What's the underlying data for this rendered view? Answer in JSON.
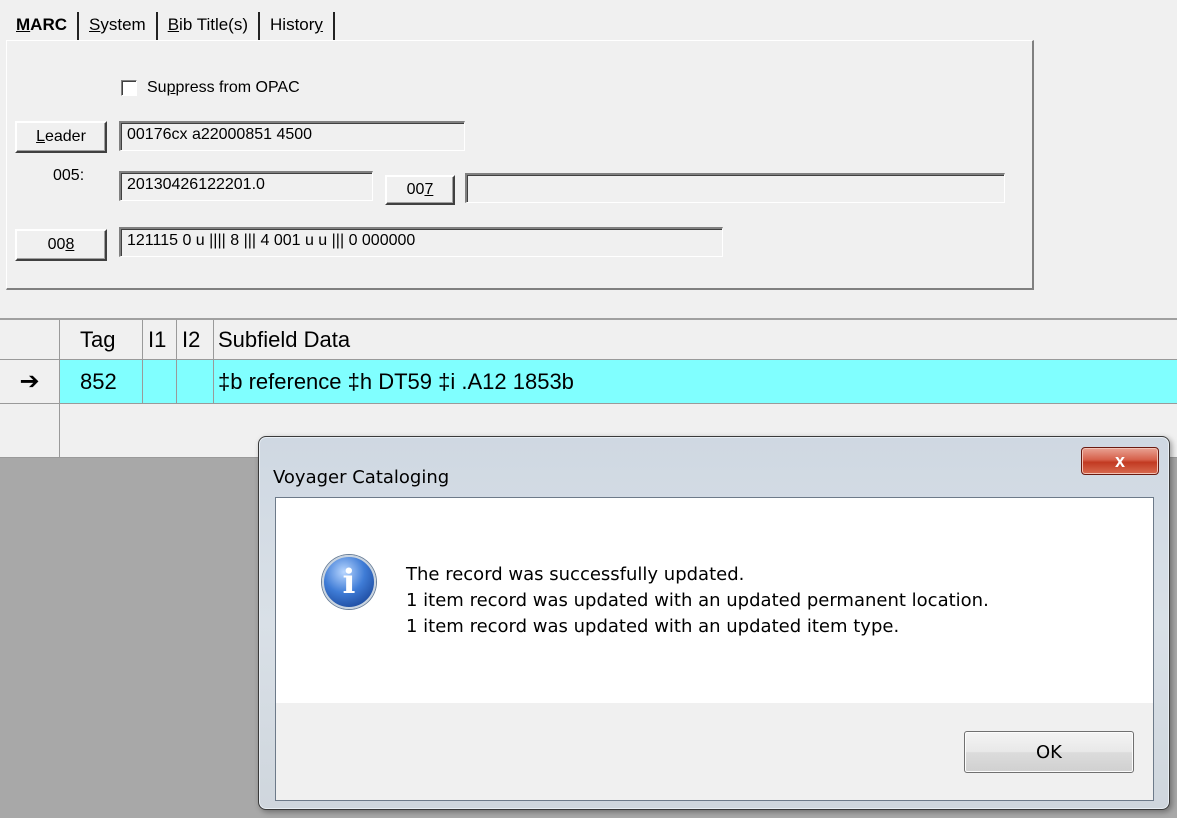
{
  "tabs": [
    {
      "label_first": "M",
      "label_rest": "ARC",
      "active": true
    },
    {
      "label_first": "S",
      "label_rest": "ystem",
      "active": false
    },
    {
      "label_first": "B",
      "label_rest": "ib Title(s)",
      "active": false
    },
    {
      "label_pre": "Histor",
      "label_ul": "y",
      "active": false
    }
  ],
  "marc": {
    "suppress_pre": "Su",
    "suppress_ul": "p",
    "suppress_post": "press from OPAC",
    "leader_btn_ul": "L",
    "leader_btn_rest": "eader",
    "leader_value": "00176cx  a22000851  4500",
    "f005_label": "005:",
    "f005_value": "20130426122201.0",
    "f007_btn_pre": "00",
    "f007_btn_ul": "7",
    "f007_value": "",
    "f008_btn_pre": "00",
    "f008_btn_ul": "8",
    "f008_value": "121115  0  u  ||||  8  |||  4  001  u  u  |||  0  000000"
  },
  "grid": {
    "headers": {
      "tag": "Tag",
      "i1": "I1",
      "i2": "I2",
      "data": "Subfield Data"
    },
    "rows": [
      {
        "marker": "➔",
        "tag": "852",
        "i1": "",
        "i2": "",
        "data": "‡b reference ‡h DT59 ‡i .A12 1853b"
      }
    ]
  },
  "dialog": {
    "title": "Voyager Cataloging",
    "close_label": "x",
    "messages": [
      "The record was successfully updated.",
      "1 item record was updated with an updated permanent location.",
      "1 item record was updated with an updated item type."
    ],
    "ok_label": "OK",
    "icon": "info-icon"
  }
}
